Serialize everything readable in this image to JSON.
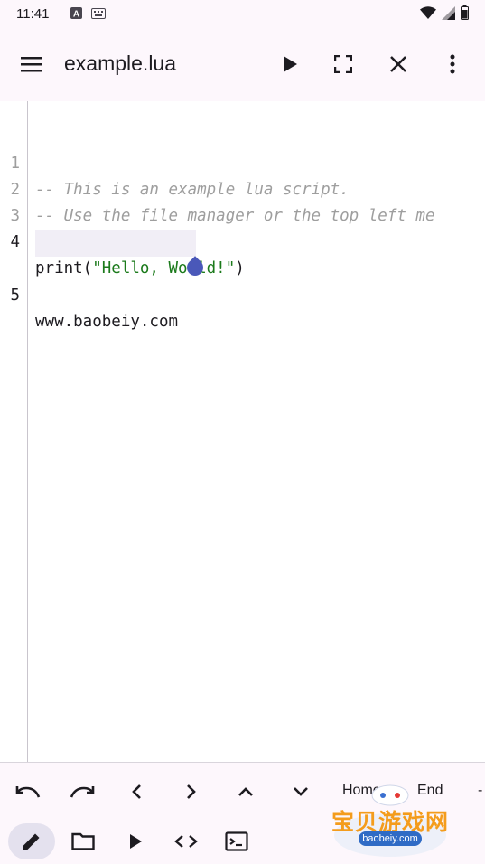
{
  "status_bar": {
    "time": "11:41",
    "icons": [
      "a-icon",
      "keyboard-icon",
      "wifi-icon",
      "signal-icon",
      "battery-icon"
    ]
  },
  "app_bar": {
    "title": "example.lua",
    "icons": [
      "menu-icon",
      "play-icon",
      "fullscreen-icon",
      "close-icon",
      "more-vert-icon"
    ]
  },
  "editor": {
    "lines": [
      {
        "number": "1",
        "text": "-- This is an example lua script."
      },
      {
        "number": "2",
        "text": "-- Use the file manager or the top left me"
      },
      {
        "number": "3",
        "text": ""
      },
      {
        "number": "4",
        "text_prefix": "print(",
        "text_string": "\"Hello, World!\"",
        "text_suffix": ")"
      },
      {
        "number": "5",
        "text": "www.baobeiy.com"
      }
    ]
  },
  "key_toolbar": {
    "home_label": "Home",
    "end_label": "End",
    "more_label": "-",
    "icons": [
      "undo-icon",
      "redo-icon",
      "arrow-left-icon",
      "arrow-right-icon",
      "arrow-up-icon",
      "arrow-down-icon"
    ]
  },
  "bottom_toolbar": {
    "icons": [
      "edit-icon",
      "folder-icon",
      "run-icon",
      "code-icon",
      "terminal-icon"
    ]
  },
  "watermark": {
    "title": "宝贝游戏网",
    "subtitle": "baobeiy.com"
  },
  "colors": {
    "background": "#fdf7fc",
    "accent": "#4a58b9",
    "string": "#1b7a1b",
    "comment": "#9e9e9e"
  }
}
